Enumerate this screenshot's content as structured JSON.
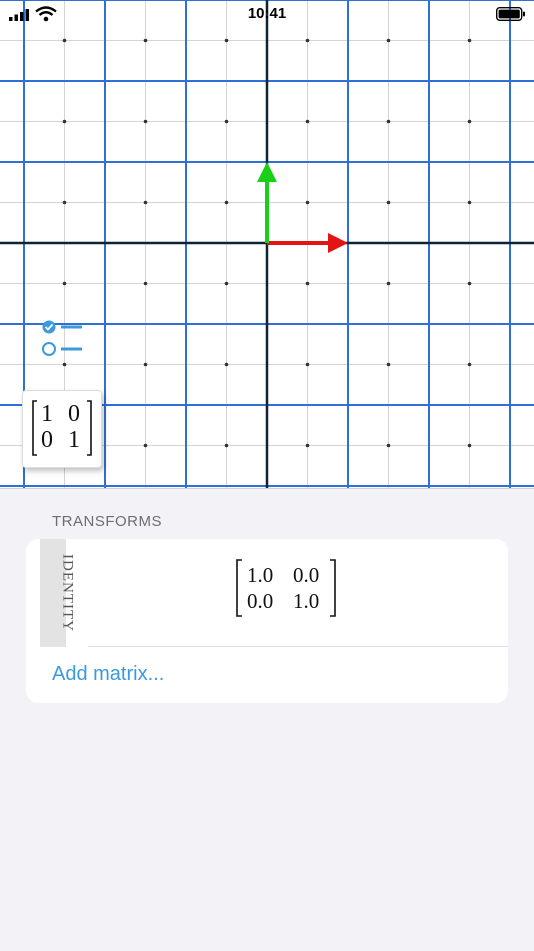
{
  "status_bar": {
    "time": "10:41",
    "signal_icon": "signal-bars-icon",
    "wifi_icon": "wifi-icon",
    "battery_icon": "battery-icon"
  },
  "canvas": {
    "colors": {
      "major_grid": "#2f6fd6",
      "minor_grid": "#d4d4d4",
      "axes": "#0d2336",
      "basis_i": "#e31414",
      "basis_j": "#17d017",
      "accent": "#3b9ad9"
    },
    "basis_vectors": [
      {
        "name": "i-hat",
        "x": 1,
        "y": 0
      },
      {
        "name": "j-hat",
        "x": 0,
        "y": 1
      }
    ],
    "toggles": [
      {
        "icon": "checked-circle-icon",
        "checked": true
      },
      {
        "icon": "empty-circle-icon",
        "checked": false
      }
    ],
    "preview_matrix": [
      [
        "1",
        "0"
      ],
      [
        "0",
        "1"
      ]
    ]
  },
  "panel": {
    "section_title": "TRANSFORMS",
    "transform": {
      "label": "IDENTITY",
      "matrix": [
        [
          "1.0",
          "0.0"
        ],
        [
          "0.0",
          "1.0"
        ]
      ]
    },
    "add_label": "Add matrix..."
  }
}
